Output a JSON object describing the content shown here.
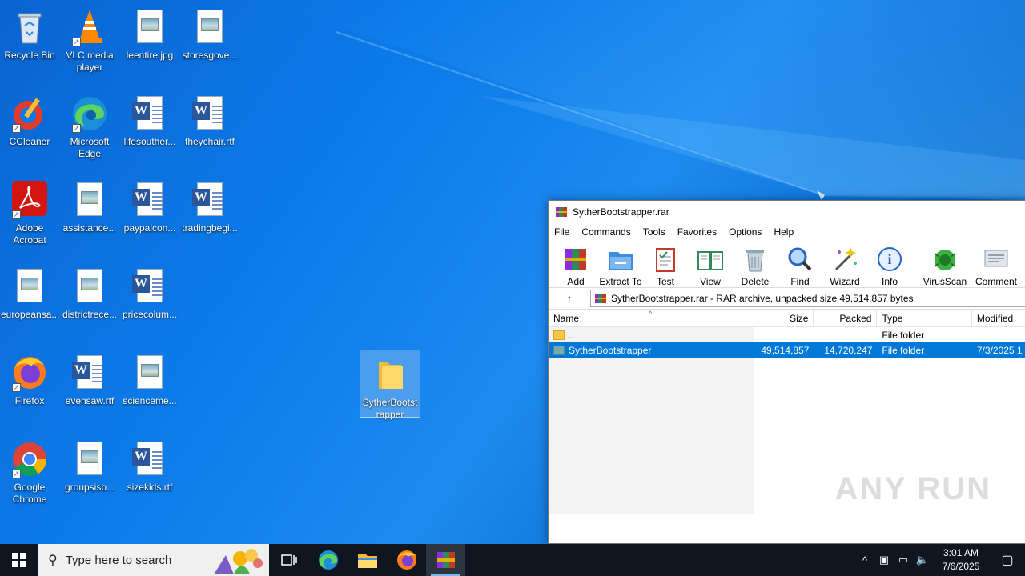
{
  "desktop": {
    "icons": [
      {
        "label": "Recycle Bin"
      },
      {
        "label": "VLC media player"
      },
      {
        "label": "leentire.jpg"
      },
      {
        "label": "storesgove..."
      },
      {
        "label": "CCleaner"
      },
      {
        "label": "Microsoft Edge"
      },
      {
        "label": "lifesouther..."
      },
      {
        "label": "theychair.rtf"
      },
      {
        "label": "Adobe Acrobat"
      },
      {
        "label": "assistance..."
      },
      {
        "label": "paypalcon..."
      },
      {
        "label": "tradingbegi..."
      },
      {
        "label": "europeansa..."
      },
      {
        "label": "districtrece..."
      },
      {
        "label": "pricecolum..."
      },
      {
        "label": "Firefox"
      },
      {
        "label": "evensaw.rtf"
      },
      {
        "label": "scienceme..."
      },
      {
        "label": "Google Chrome"
      },
      {
        "label": "groupsisb..."
      },
      {
        "label": "sizekids.rtf"
      },
      {
        "label": "SytherBootstrapper"
      }
    ]
  },
  "winrar": {
    "title": "SytherBootstrapper.rar",
    "menu": [
      "File",
      "Commands",
      "Tools",
      "Favorites",
      "Options",
      "Help"
    ],
    "toolbar": [
      "Add",
      "Extract To",
      "Test",
      "View",
      "Delete",
      "Find",
      "Wizard",
      "Info",
      "VirusScan",
      "Comment"
    ],
    "address": "SytherBootstrapper.rar - RAR archive, unpacked size 49,514,857 bytes",
    "columns": {
      "name": "Name",
      "size": "Size",
      "packed": "Packed",
      "type": "Type",
      "modified": "Modified"
    },
    "rows": [
      {
        "name": "..",
        "size": "",
        "packed": "",
        "type": "File folder",
        "modified": ""
      },
      {
        "name": "SytherBootstrapper",
        "size": "49,514,857",
        "packed": "14,720,247",
        "type": "File folder",
        "modified": "7/3/2025 1"
      }
    ],
    "watermark": "ANY RUN"
  },
  "taskbar": {
    "search_placeholder": "Type here to search",
    "time": "3:01 AM",
    "date": "7/6/2025"
  }
}
